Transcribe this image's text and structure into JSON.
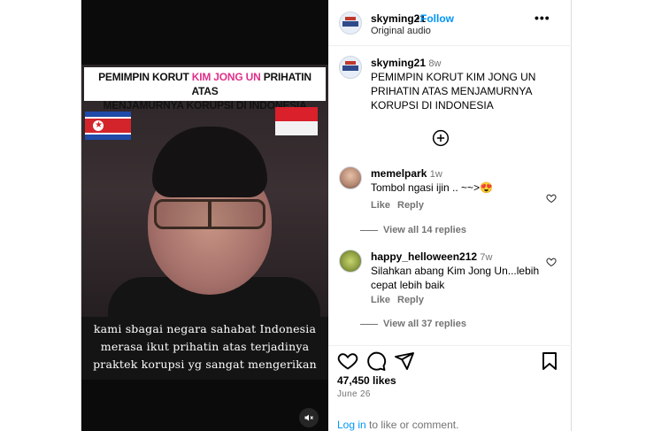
{
  "video": {
    "headline_pre": "PEMIMPIN KORUT ",
    "headline_highlight": "KIM JONG UN",
    "headline_post": " PRIHATIN ATAS",
    "headline_line2": "MENJAMURNYA KORUPSI DI INDONESIA",
    "caption_lines": [
      "kami sbagai negara sahabat Indonesia",
      "merasa ikut prihatin atas terjadinya",
      "praktek korupsi yg sangat mengerikan"
    ]
  },
  "header": {
    "username": "skyming21",
    "follow_label": "Follow",
    "separator": "•",
    "audio": "Original audio",
    "more_label": "•••"
  },
  "caption": {
    "username": "skyming21",
    "age": "8w",
    "text": "PEMIMPIN KORUT KIM JONG UN PRIHATIN ATAS MENJAMURNYA KORUPSI DI INDONESIA"
  },
  "comments": [
    {
      "username": "memelpark",
      "age": "1w",
      "text": "Tombol ngasi ijin .. ~~>😍",
      "like_label": "Like",
      "reply_label": "Reply",
      "view_replies": "View all 14 replies"
    },
    {
      "username": "happy_helloween212",
      "age": "7w",
      "text": "Silahkan abang Kim Jong Un...lebih cepat lebih baik",
      "like_label": "Like",
      "reply_label": "Reply",
      "view_replies": "View all 37 replies"
    }
  ],
  "footer": {
    "likes": "47,450 likes",
    "date": "June 26",
    "login_link": "Log in",
    "login_rest": " to like or comment."
  }
}
